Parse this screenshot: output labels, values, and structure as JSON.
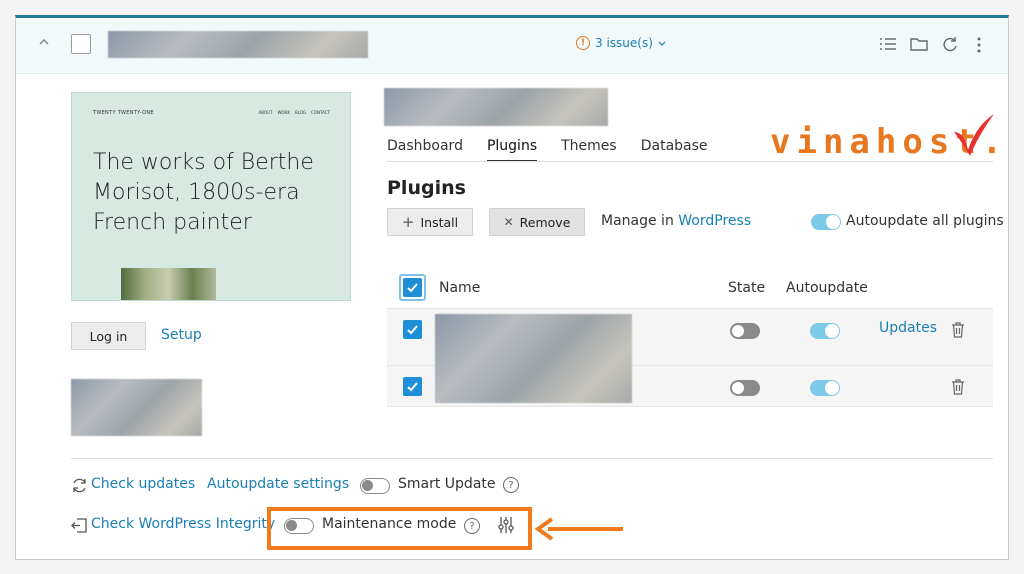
{
  "header": {
    "issues_label": "3 issue(s)"
  },
  "preview": {
    "site_title": "TWENTY TWENTY-ONE",
    "nav": [
      "ABOUT",
      "WORK",
      "BLOG",
      "CONTACT"
    ],
    "headline": "The works of Berthe Morisot, 1800s-era French painter"
  },
  "left": {
    "login_label": "Log in",
    "setup_label": "Setup"
  },
  "logo": {
    "text": "vinahost."
  },
  "tabs": [
    {
      "label": "Dashboard",
      "active": false
    },
    {
      "label": "Plugins",
      "active": true
    },
    {
      "label": "Themes",
      "active": false
    },
    {
      "label": "Database",
      "active": false
    }
  ],
  "plugins": {
    "heading": "Plugins",
    "install_label": "Install",
    "remove_label": "Remove",
    "manage_prefix": "Manage in",
    "manage_link": "WordPress",
    "autoupdate_all_label": "Autoupdate all plugins",
    "table": {
      "col_name": "Name",
      "col_state": "State",
      "col_autoupdate": "Autoupdate"
    },
    "row1_updates_label": "Updates"
  },
  "footer": {
    "check_updates": "Check updates",
    "autoupdate_settings": "Autoupdate settings",
    "smart_update": "Smart Update",
    "check_integrity": "Check WordPress Integrity",
    "maintenance_mode": "Maintenance mode"
  },
  "colors": {
    "accent": "#1a7fb5",
    "checkbox": "#1d8fd6",
    "toggle_on": "#7cc9e8",
    "warning": "#e07b1f",
    "highlight": "#f07a1d",
    "top_border": "#1d7e92"
  }
}
